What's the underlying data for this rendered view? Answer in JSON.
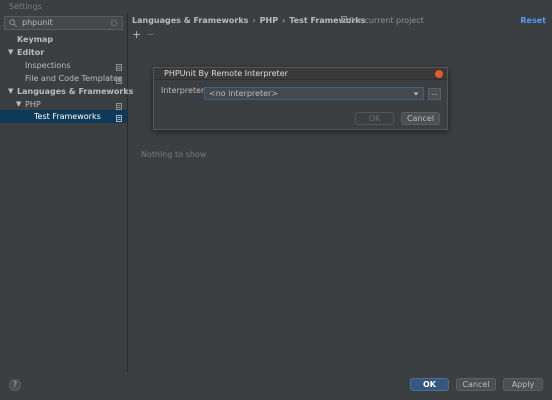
{
  "window": {
    "title": "Settings"
  },
  "search": {
    "value": "phpunit"
  },
  "sidebar": {
    "items": [
      {
        "label": "Keymap"
      },
      {
        "label": "Editor"
      },
      {
        "label": "Inspections"
      },
      {
        "label": "File and Code Templates"
      },
      {
        "label": "Languages & Frameworks"
      },
      {
        "label": "PHP"
      },
      {
        "label": "Test Frameworks"
      }
    ]
  },
  "breadcrumb": {
    "items": [
      "Languages & Frameworks",
      "PHP",
      "Test Frameworks"
    ],
    "separator": "›"
  },
  "scope": {
    "label": "For current project"
  },
  "header": {
    "reset_label": "Reset"
  },
  "toolbar": {
    "add_label": "+",
    "remove_label": "−"
  },
  "main": {
    "empty_text": "Nothing to show"
  },
  "dialog": {
    "title": "PHPUnit By Remote Interpreter",
    "interpreter_label": "Interpreter:",
    "interpreter_value": "<no interpreter>",
    "browse_label": "...",
    "ok_label": "OK",
    "cancel_label": "Cancel"
  },
  "footer": {
    "help_label": "?",
    "ok_label": "OK",
    "cancel_label": "Cancel",
    "apply_label": "Apply"
  },
  "colors": {
    "selection": "#0d3a58",
    "accent": "#589df6",
    "primary_button": "#365880",
    "close_button": "#e05a2a"
  }
}
